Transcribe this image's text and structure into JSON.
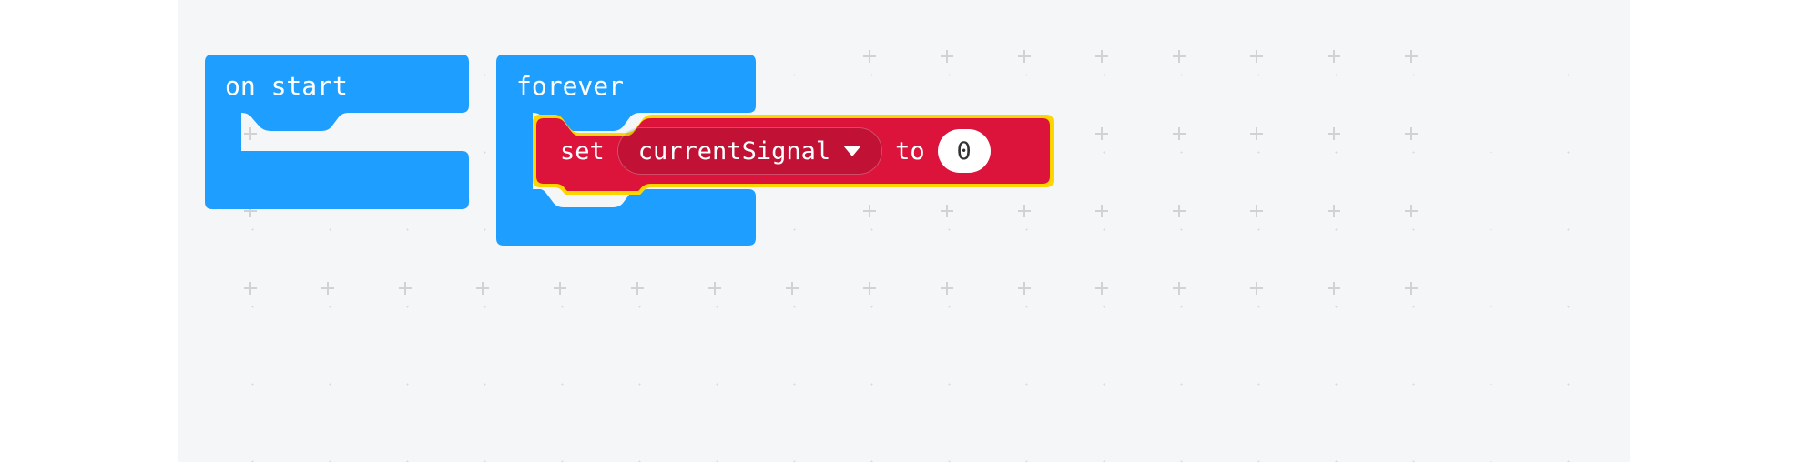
{
  "workspace": {
    "blocks": {
      "onStart": {
        "label": "on start"
      },
      "forever": {
        "label": "forever"
      },
      "setVariable": {
        "keyword_set": "set",
        "variable_name": "currentSignal",
        "keyword_to": "to",
        "value": "0"
      }
    },
    "colors": {
      "event_blue": "#1e9fff",
      "variable_red": "#dc143c",
      "highlight_yellow": "#ffd500",
      "canvas_bg": "#f5f6f7"
    }
  }
}
